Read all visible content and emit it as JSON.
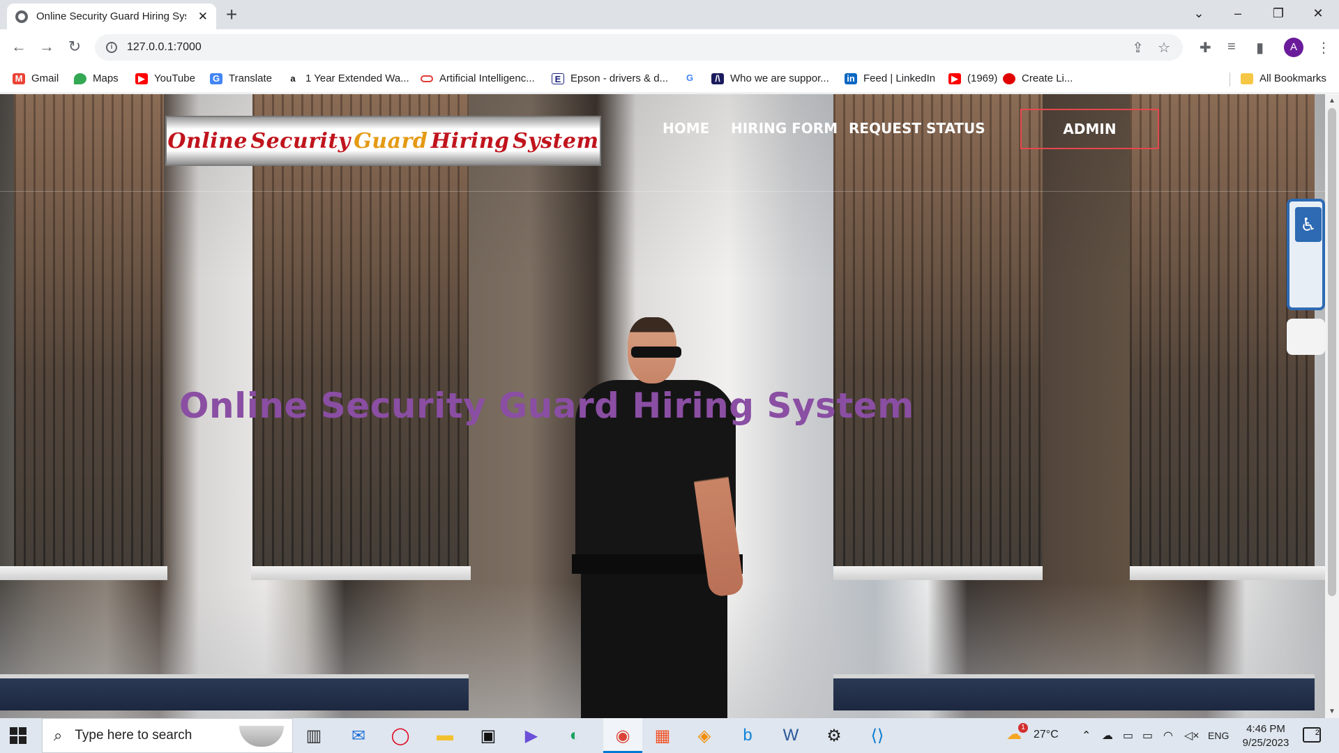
{
  "browser": {
    "tab_title": "Online Security Guard Hiring Sys",
    "url": "127.0.0.1:7000",
    "profile_initial": "A",
    "bookmarks": [
      "Gmail",
      "Maps",
      "YouTube",
      "Translate",
      "1 Year Extended Wa...",
      "Artificial Intelligenc...",
      "Epson - drivers & d...",
      "Who we are suppor...",
      "Feed | LinkedIn",
      "(1969)",
      "Create Li..."
    ],
    "all_bookmarks": "All Bookmarks"
  },
  "site": {
    "logo": {
      "word1": "Online",
      "word2": "Security",
      "word3": "Guard",
      "word4": "Hiring",
      "word5": "System"
    },
    "nav": {
      "home": "HOME",
      "hiring_form": "HIRING FORM",
      "request_status": "REQUEST STATUS",
      "admin": "ADMIN"
    },
    "hero_title": "Online Security Guard Hiring System",
    "colors": {
      "hero_title": "#8a4ea3",
      "admin_border": "#e5484d",
      "logo_red": "#c0141d",
      "logo_gold": "#e59a14"
    }
  },
  "taskbar": {
    "search_placeholder": "Type here to search",
    "weather": "27°C",
    "weather_badge": "1",
    "language": "ENG",
    "time": "4:46 PM",
    "date": "9/25/2023",
    "notifications": "2"
  }
}
